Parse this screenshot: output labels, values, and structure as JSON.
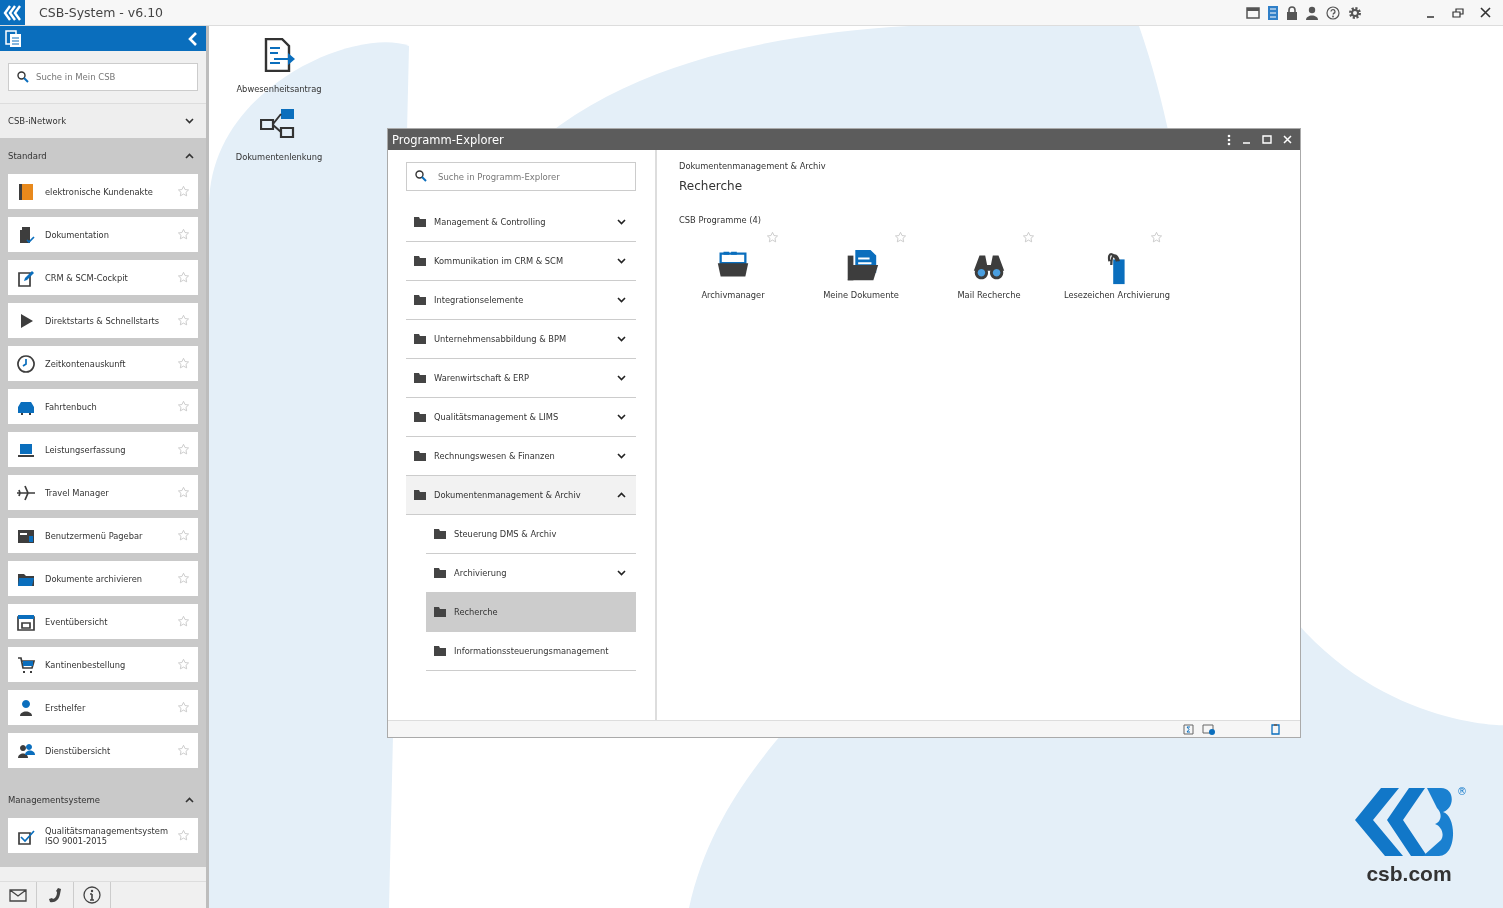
{
  "window": {
    "title": "CSB-System - v6.10"
  },
  "sidebar": {
    "search": {
      "placeholder": "Suche in Mein CSB"
    },
    "sections": [
      {
        "title": "CSB-iNetwork",
        "expanded": false
      },
      {
        "title": "Standard",
        "expanded": true,
        "items": [
          {
            "label": "elektronische Kundenakte"
          },
          {
            "label": "Dokumentation"
          },
          {
            "label": "CRM & SCM-Cockpit"
          },
          {
            "label": "Direktstarts & Schnellstarts"
          },
          {
            "label": "Zeitkontenauskunft"
          },
          {
            "label": "Fahrtenbuch"
          },
          {
            "label": "Leistungserfassung"
          },
          {
            "label": "Travel Manager"
          },
          {
            "label": "Benutzermenü Pagebar"
          },
          {
            "label": "Dokumente archivieren"
          },
          {
            "label": "Eventübersicht"
          },
          {
            "label": "Kantinenbestellung"
          },
          {
            "label": "Ersthelfer"
          },
          {
            "label": "Dienstübersicht"
          }
        ]
      },
      {
        "title": "Managementsysteme",
        "expanded": true,
        "items": [
          {
            "label": "Qualitätsmanagementsystem ISO 9001-2015"
          }
        ]
      }
    ]
  },
  "desktop_icons": [
    {
      "label": "Abwesenheitsantrag"
    },
    {
      "label": "Dokumentenlenkung"
    }
  ],
  "explorer": {
    "title": "Programm-Explorer",
    "search": {
      "placeholder": "Suche in Programm-Explorer"
    },
    "tree": [
      {
        "label": "Management & Controlling",
        "expanded": false,
        "selected": false
      },
      {
        "label": "Kommunikation im CRM & SCM",
        "expanded": false,
        "selected": false
      },
      {
        "label": "Integrationselemente",
        "expanded": false,
        "selected": false
      },
      {
        "label": "Unternehmensabbildung & BPM",
        "expanded": false,
        "selected": false
      },
      {
        "label": "Warenwirtschaft & ERP",
        "expanded": false,
        "selected": false
      },
      {
        "label": "Qualitätsmanagement & LIMS",
        "expanded": false,
        "selected": false
      },
      {
        "label": "Rechnungswesen & Finanzen",
        "expanded": false,
        "selected": false
      },
      {
        "label": "Dokumentenmanagement & Archiv",
        "expanded": true,
        "selected": false,
        "children": [
          {
            "label": "Steuerung DMS & Archiv",
            "selected": false
          },
          {
            "label": "Archivierung",
            "expanded": false,
            "selected": false
          },
          {
            "label": "Recherche",
            "selected": true
          },
          {
            "label": "Informationssteuerungsmanagement",
            "selected": false
          }
        ]
      }
    ],
    "content": {
      "breadcrumb": "Dokumentenmanagement & Archiv",
      "title": "Recherche",
      "section": "CSB Programme (4)",
      "programs": [
        {
          "label": "Archivmanager"
        },
        {
          "label": "Meine Dokumente"
        },
        {
          "label": "Mail Recherche"
        },
        {
          "label": "Lesezeichen Archivierung"
        }
      ]
    }
  },
  "logo": {
    "text": "csb.com",
    "mark": "®"
  }
}
